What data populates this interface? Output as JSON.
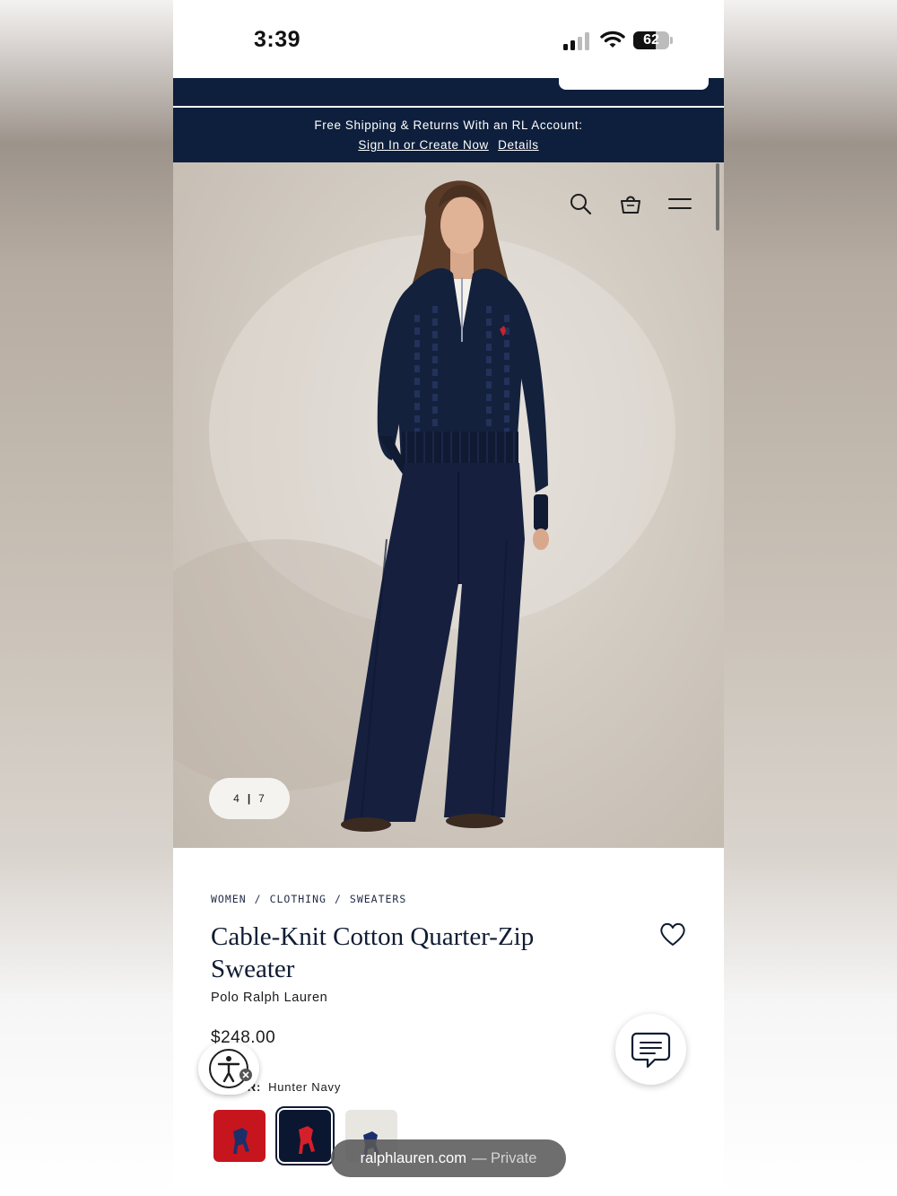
{
  "status_bar": {
    "time": "3:39",
    "battery": "62",
    "battery_level_percent": 62
  },
  "promo": {
    "line1": "Free Shipping & Returns With an RL Account:",
    "sign_in_link": "Sign In or Create Now",
    "details_link": "Details"
  },
  "header_icons": [
    "search-icon",
    "shopping-bag-icon",
    "menu-icon"
  ],
  "gallery": {
    "current": "4",
    "total": "7",
    "separator": "|"
  },
  "breadcrumb": {
    "items": [
      "WOMEN",
      "CLOTHING",
      "SWEATERS"
    ],
    "separator": "/"
  },
  "product": {
    "title": "Cable-Knit Cotton Quarter-Zip Sweater",
    "brand": "Polo Ralph Lauren",
    "price": "$248.00",
    "color_label": "COLOR:",
    "color_value": "Hunter Navy"
  },
  "swatches": [
    {
      "color": "#c7151e",
      "logo": "#1c2f6b",
      "selected": false
    },
    {
      "color": "#0b1630",
      "logo": "#d3202a",
      "selected": true
    },
    {
      "color": "#e8e6e1",
      "logo": "#1c2f6b",
      "selected": false
    }
  ],
  "url_bar": {
    "domain": "ralphlauren.com",
    "mode": "— Private"
  },
  "colors": {
    "navy": "#0d1f3c",
    "brand_text": "#101c33"
  }
}
